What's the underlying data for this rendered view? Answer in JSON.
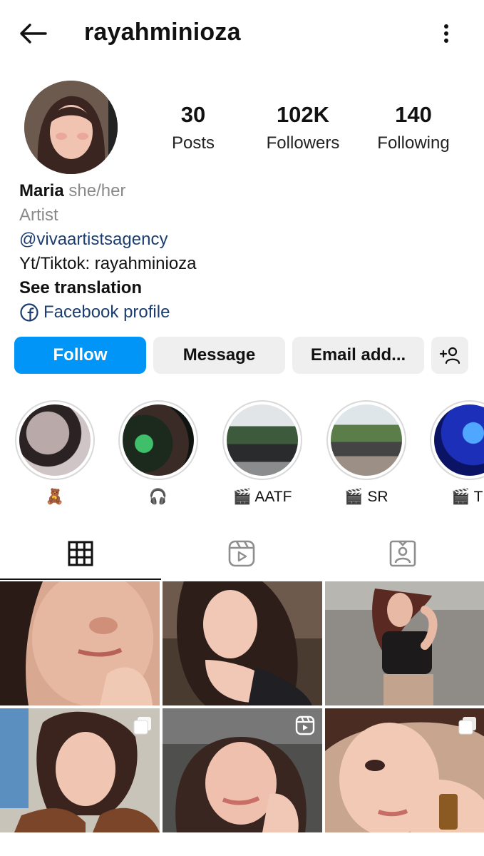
{
  "header": {
    "username": "rayahminioza",
    "back_icon": "arrow-left-icon",
    "more_icon": "more-vertical-icon"
  },
  "stats": [
    {
      "value": "30",
      "label": "Posts"
    },
    {
      "value": "102K",
      "label": "Followers"
    },
    {
      "value": "140",
      "label": "Following"
    }
  ],
  "bio": {
    "name": "Maria",
    "pronouns": "she/her",
    "category": "Artist",
    "mention": "@vivaartistsagency",
    "text": "Yt/Tiktok: rayahminioza",
    "see_translation": "See translation",
    "facebook_label": "Facebook profile"
  },
  "actions": {
    "follow": "Follow",
    "message": "Message",
    "email": "Email add..."
  },
  "highlights": [
    {
      "label": "🧸"
    },
    {
      "label": "🎧"
    },
    {
      "label": "🎬 AATF"
    },
    {
      "label": "🎬 SR"
    },
    {
      "label": "🎬 T"
    }
  ],
  "colors": {
    "follow_blue": "#0095f6",
    "link_blue": "#1c3d6e",
    "button_gray": "#efefef"
  }
}
